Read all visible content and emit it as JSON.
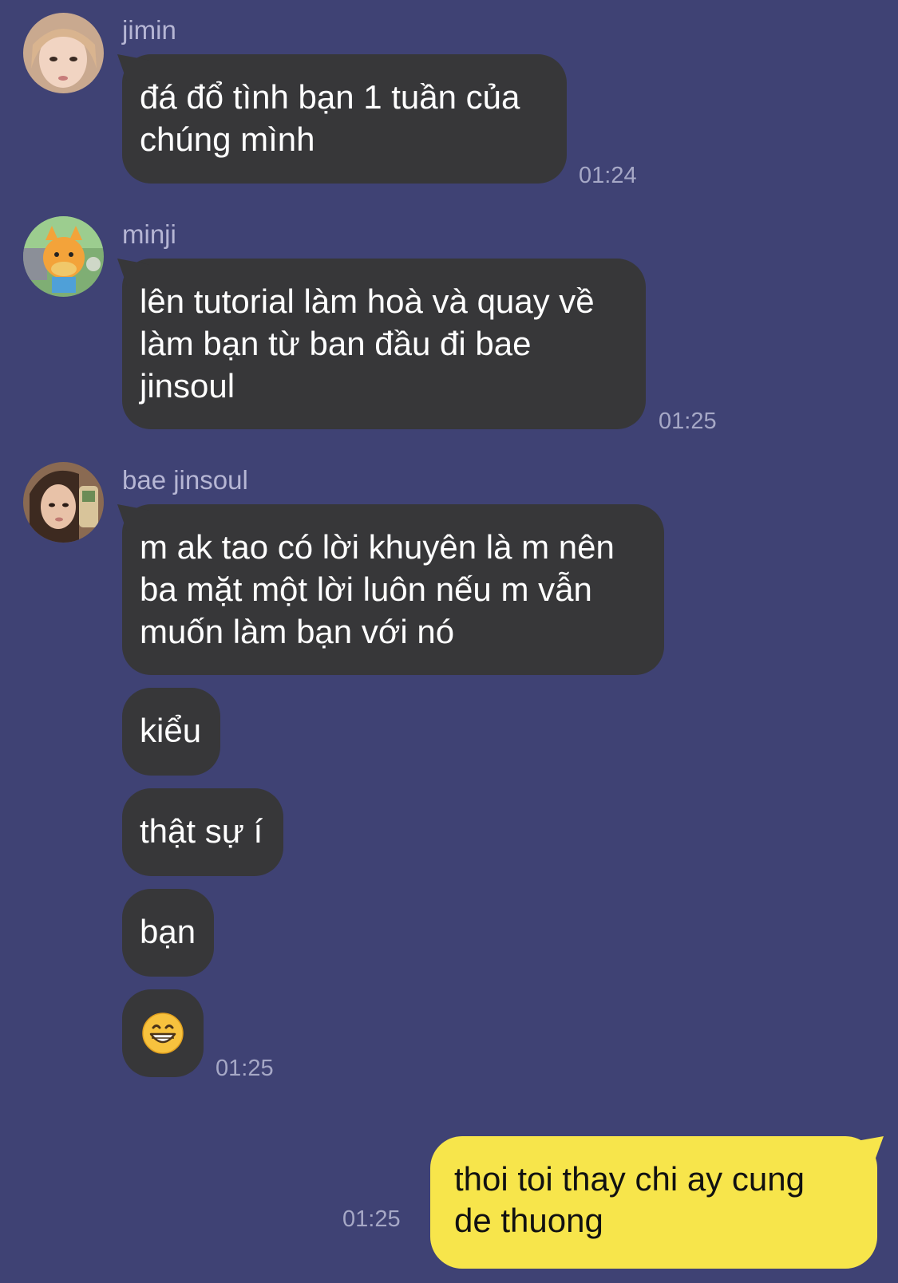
{
  "theme": {
    "background": "#3f4274",
    "incoming_bubble": "#373739",
    "outgoing_bubble": "#f7e54b",
    "incoming_text": "#ffffff",
    "outgoing_text": "#111111",
    "sender_name": "#b6b6d4",
    "timestamp": "#a6a8c6"
  },
  "messages": {
    "jimin": {
      "sender": "jimin",
      "avatar_icon": "user-avatar-photo",
      "bubble1": [
        "đá đổ tình bạn 1 tuần của",
        "chúng mình"
      ],
      "time": "01:24"
    },
    "minji": {
      "sender": "minji",
      "avatar_icon": "cartoon-cat-avatar",
      "bubble1": [
        "lên tutorial làm hoà và quay về",
        "làm bạn từ ban đầu đi bae",
        "jinsoul"
      ],
      "time": "01:25"
    },
    "jinsoul": {
      "sender": "bae jinsoul",
      "avatar_icon": "user-avatar-photo",
      "bubble1": [
        "m ak tao có lời khuyên là m nên",
        "ba mặt một lời luôn nếu m vẫn",
        "muốn làm bạn với nó"
      ],
      "bubble2": "kiểu",
      "bubble3": "thật sự í",
      "bubble4": "bạn",
      "bubble5": "😁",
      "time": "01:25"
    },
    "me": {
      "bubble1": [
        "thoi toi thay chi ay cung",
        "de thuong"
      ],
      "time": "01:25"
    }
  }
}
